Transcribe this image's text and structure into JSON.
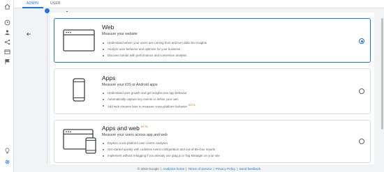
{
  "tabs": [
    {
      "label": "ADMIN",
      "active": true
    },
    {
      "label": "USER",
      "active": false
    }
  ],
  "rail_icons": [
    "home-icon",
    "clock-icon",
    "person-icon",
    "share-icon",
    "table-icon",
    "flag-icon",
    "lightbulb-icon",
    "gear-icon"
  ],
  "options": [
    {
      "title": "Web",
      "beta": "",
      "subtitle": "Measure your website",
      "bullets": [
        {
          "text": "Understand where your users are coming from and turn data into insights",
          "beta": ""
        },
        {
          "text": "Analyze user behavior and optimize for your business",
          "beta": ""
        },
        {
          "text": "Discover trends with performance and conversion analysis",
          "beta": ""
        }
      ],
      "selected": true
    },
    {
      "title": "Apps",
      "beta": "",
      "subtitle": "Measure your iOS or Android apps",
      "bullets": [
        {
          "text": "Understand user growth and get insights into app behavior",
          "beta": ""
        },
        {
          "text": "Automatically capture key events or define your own",
          "beta": ""
        },
        {
          "text": "Add web streams later to measure cross-platform behavior",
          "beta": "BETA"
        }
      ],
      "selected": false
    },
    {
      "title": "Apps and web",
      "beta": "BETA",
      "subtitle": "Measure your users across app and web",
      "bullets": [
        {
          "text": "Explore cross-platform user-centric analytics",
          "beta": ""
        },
        {
          "text": "Get started quickly with codeless event configuration and out-of-the-box reports",
          "beta": ""
        },
        {
          "text": "Implement without retagging if you already use gtag.js or Tag Manager on your site",
          "beta": ""
        }
      ],
      "selected": false
    }
  ],
  "footer": {
    "copyright": "© 2019 Google",
    "links": [
      "Analytics home",
      "Terms of Service",
      "Privacy Policy",
      "Send feedback"
    ]
  },
  "colors": {
    "accent": "#1a73e8",
    "beta": "#e8710a"
  }
}
